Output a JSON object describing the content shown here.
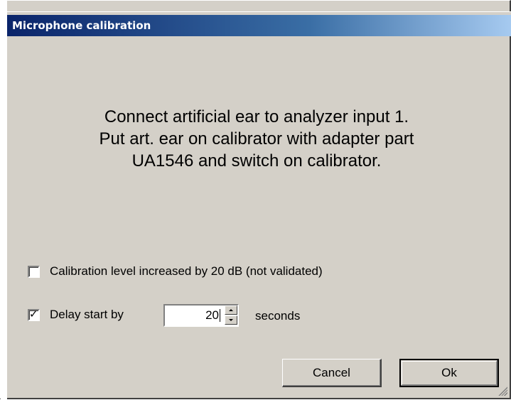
{
  "window": {
    "title": "Microphone calibration"
  },
  "message": {
    "line1": "Connect artificial ear to analyzer input 1.",
    "line2": "Put art. ear on calibrator with adapter part",
    "line3": "UA1546 and switch on calibrator."
  },
  "options": {
    "calibration_level": {
      "label": "Calibration level increased by 20 dB (not validated)",
      "checked": false
    },
    "delay_start": {
      "label": "Delay start by",
      "checked": true,
      "value": "20",
      "unit": "seconds"
    }
  },
  "buttons": {
    "cancel": "Cancel",
    "ok": "Ok"
  },
  "icons": {
    "check": "✓"
  }
}
